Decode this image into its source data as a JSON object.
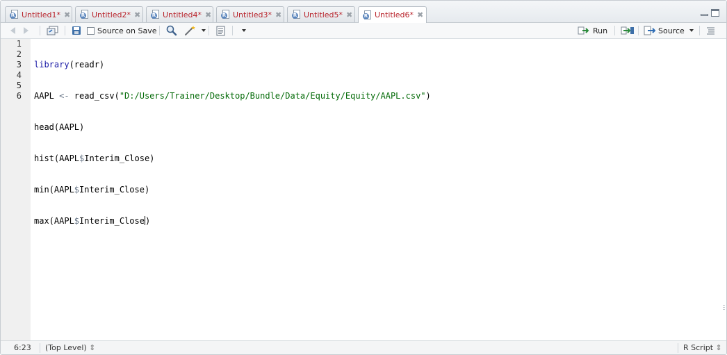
{
  "tabs": [
    {
      "label": "Untitled1*"
    },
    {
      "label": "Untitled2*"
    },
    {
      "label": "Untitled4*"
    },
    {
      "label": "Untitled3*"
    },
    {
      "label": "Untitled5*"
    },
    {
      "label": "Untitled6*"
    }
  ],
  "active_tab": "Untitled6*",
  "toolbar": {
    "source_on_save_label": "Source on Save",
    "source_on_save_checked": false,
    "run_label": "Run",
    "source_label": "Source"
  },
  "editor": {
    "line_numbers": [
      "1",
      "2",
      "3",
      "4",
      "5",
      "6"
    ],
    "lines": [
      "library(readr)",
      "AAPL <- read_csv(\"D:/Users/Trainer/Desktop/Bundle/Data/Equity/Equity/AAPL.csv\")",
      "head(AAPL)",
      "hist(AAPL$Interim_Close)",
      "min(AAPL$Interim_Close)",
      "max(AAPL$Interim_Close)"
    ],
    "code_parts": {
      "l1_fn": "library",
      "l1_arg": "(readr)",
      "l2_var": "AAPL ",
      "l2_op": "<-",
      "l2_fn": " read_csv(",
      "l2_str": "\"D:/Users/Trainer/Desktop/Bundle/Data/Equity/Equity/AAPL.csv\"",
      "l2_close": ")",
      "l3_fn": "head(AAPL)",
      "l4_a": "hist(AAPL",
      "l4_dollar": "$",
      "l4_b": "Interim_Close)",
      "l5_a": "min(AAPL",
      "l5_dollar": "$",
      "l5_b": "Interim_Close)",
      "l6_a": "max(AAPL",
      "l6_dollar": "$",
      "l6_b": "Interim_Close",
      "l6_c": ")"
    }
  },
  "status": {
    "position": "6:23",
    "scope": "(Top Level)",
    "scope_arrows": "⇕",
    "filetype": "R Script",
    "filetype_arrows": "⇕"
  },
  "colors": {
    "tab_label": "#b8222a",
    "keyword": "#1a1aa6",
    "string": "#036a07",
    "operator": "#687687",
    "gutter": "#f0f0f0"
  },
  "icons": [
    "r-file-icon",
    "close-icon",
    "back-arrow-icon",
    "forward-arrow-icon",
    "show-in-window-icon",
    "save-icon",
    "search-icon",
    "magic-wand-icon",
    "compile-report-icon",
    "run-icon",
    "rerun-icon",
    "source-icon",
    "outline-icon"
  ]
}
